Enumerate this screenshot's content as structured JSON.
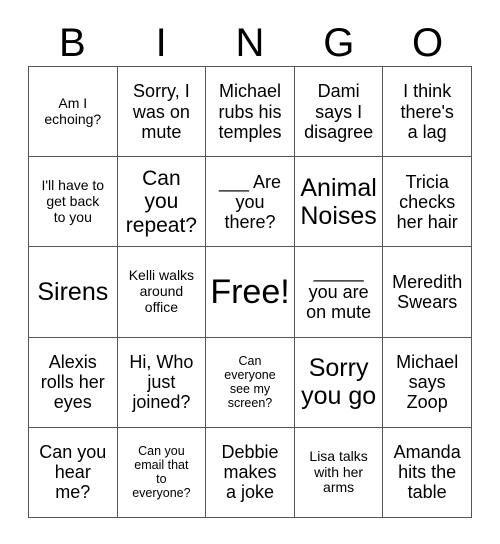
{
  "title": "BINGO",
  "header": {
    "letters": [
      "B",
      "I",
      "N",
      "G",
      "O"
    ]
  },
  "colors": {
    "text": "#000000",
    "border": "#555555",
    "background": "#ffffff"
  },
  "grid": {
    "rows": 5,
    "columns": 5,
    "free_space_index": 12,
    "cells": [
      {
        "text": "Am I\necho​ing?",
        "size": "sm"
      },
      {
        "text": "Sorry, I\nwas on\nmute",
        "size": "md"
      },
      {
        "text": "Michael\nrubs his\ntemples",
        "size": "md"
      },
      {
        "text": "Dami\nsays I\ndisagree",
        "size": "md"
      },
      {
        "text": "I think\nthere's\na lag",
        "size": "md"
      },
      {
        "text": "I'll have to\nget back\nto you",
        "size": "sm"
      },
      {
        "text": "Can\nyou\nrepeat?",
        "size": "lg"
      },
      {
        "text": "___ Are\nyou\nthere?",
        "size": "md"
      },
      {
        "text": "Animal\nNoises",
        "size": "xl"
      },
      {
        "text": "Tricia\nchecks\nher hair",
        "size": "md"
      },
      {
        "text": "Sirens",
        "size": "xl"
      },
      {
        "text": "Kelli walks\naround\noffice",
        "size": "sm"
      },
      {
        "text": "Free!",
        "size": "free"
      },
      {
        "text": "_____\nyou are\non mute",
        "size": "md"
      },
      {
        "text": "Meredith\nSwears",
        "size": "md"
      },
      {
        "text": "Alexis\nrolls her\neyes",
        "size": "md"
      },
      {
        "text": "Hi, Who\njust\njoined?",
        "size": "md"
      },
      {
        "text": "Can\neveryone\nsee my\nscreen?",
        "size": "xs"
      },
      {
        "text": "Sorry\nyou go",
        "size": "xl"
      },
      {
        "text": "Michael\nsays\nZoop",
        "size": "md"
      },
      {
        "text": "Can you\nhear\nme?",
        "size": "md"
      },
      {
        "text": "Can you\nemail that\nto\neveryone?",
        "size": "xs"
      },
      {
        "text": "Debbie\nmakes\na joke",
        "size": "md"
      },
      {
        "text": "Lisa talks\nwith her\narms",
        "size": "sm"
      },
      {
        "text": "Amanda\nhits the\ntable",
        "size": "md"
      }
    ]
  }
}
